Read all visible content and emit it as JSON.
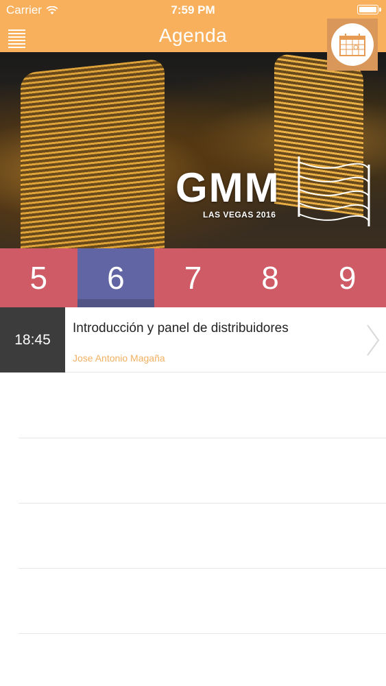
{
  "status_bar": {
    "carrier": "Carrier",
    "time": "7:59 PM",
    "wifi_icon": "wifi-icon",
    "battery_icon": "battery-icon"
  },
  "nav": {
    "title": "Agenda",
    "menu_icon": "menu-icon",
    "calendar_icon": "calendar-icon"
  },
  "hero": {
    "brand": "GMM",
    "subtitle": "LAS VEGAS 2016"
  },
  "days": [
    {
      "label": "5",
      "selected": false
    },
    {
      "label": "6",
      "selected": true
    },
    {
      "label": "7",
      "selected": false
    },
    {
      "label": "8",
      "selected": false
    },
    {
      "label": "9",
      "selected": false
    }
  ],
  "sessions": [
    {
      "time": "18:45",
      "title": "Introducción y panel de distribuidores",
      "speaker": "Jose Antonio Magaña"
    }
  ],
  "colors": {
    "accent": "#f8b05c",
    "day_bar": "#cf5b66",
    "day_selected": "#6265a4",
    "time_cell": "#3c3c3c",
    "speaker_text": "#f3b062"
  }
}
